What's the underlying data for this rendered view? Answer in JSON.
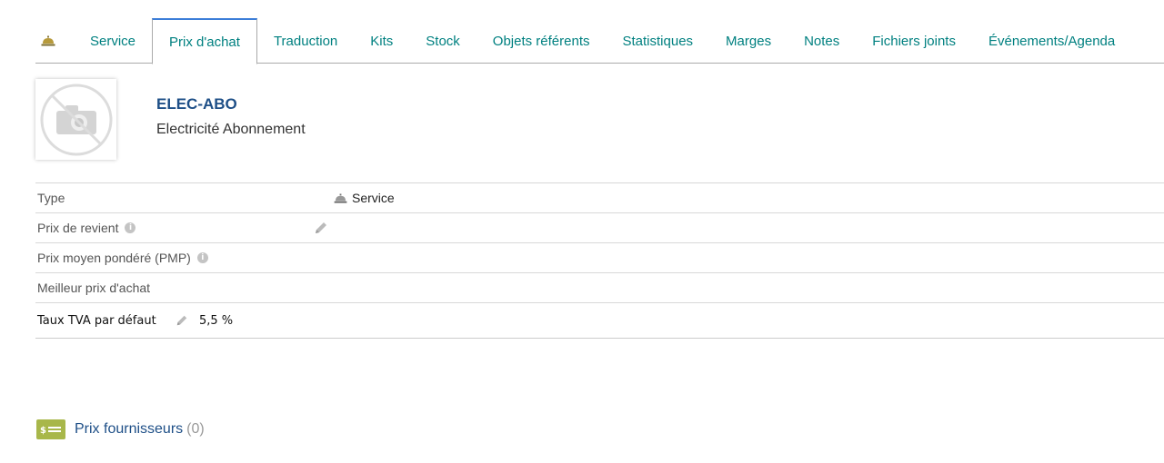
{
  "tabs": [
    {
      "label": "",
      "icon": "service-bell-icon"
    },
    {
      "label": "Service"
    },
    {
      "label": "Prix d'achat",
      "active": true
    },
    {
      "label": "Traduction"
    },
    {
      "label": "Kits"
    },
    {
      "label": "Stock"
    },
    {
      "label": "Objets référents"
    },
    {
      "label": "Statistiques"
    },
    {
      "label": "Marges"
    },
    {
      "label": "Notes"
    },
    {
      "label": "Fichiers joints"
    },
    {
      "label": "Événements/Agenda"
    }
  ],
  "product": {
    "ref": "ELEC-ABO",
    "label": "Electricité Abonnement"
  },
  "fields": {
    "type": {
      "label": "Type",
      "value": "Service"
    },
    "cost_price": {
      "label": "Prix de revient"
    },
    "pmp": {
      "label": "Prix moyen pondéré (PMP)"
    },
    "best_price": {
      "label": "Meilleur prix d'achat"
    },
    "vat": {
      "label": "Taux TVA par défaut",
      "value": "5,5 %"
    }
  },
  "suppliers": {
    "title": "Prix fournisseurs",
    "count": "(0)"
  },
  "colors": {
    "link": "#008080",
    "title": "#1e4f87",
    "active_tab_border": "#3b7dd8",
    "supplier_icon": "#a8b74a"
  }
}
